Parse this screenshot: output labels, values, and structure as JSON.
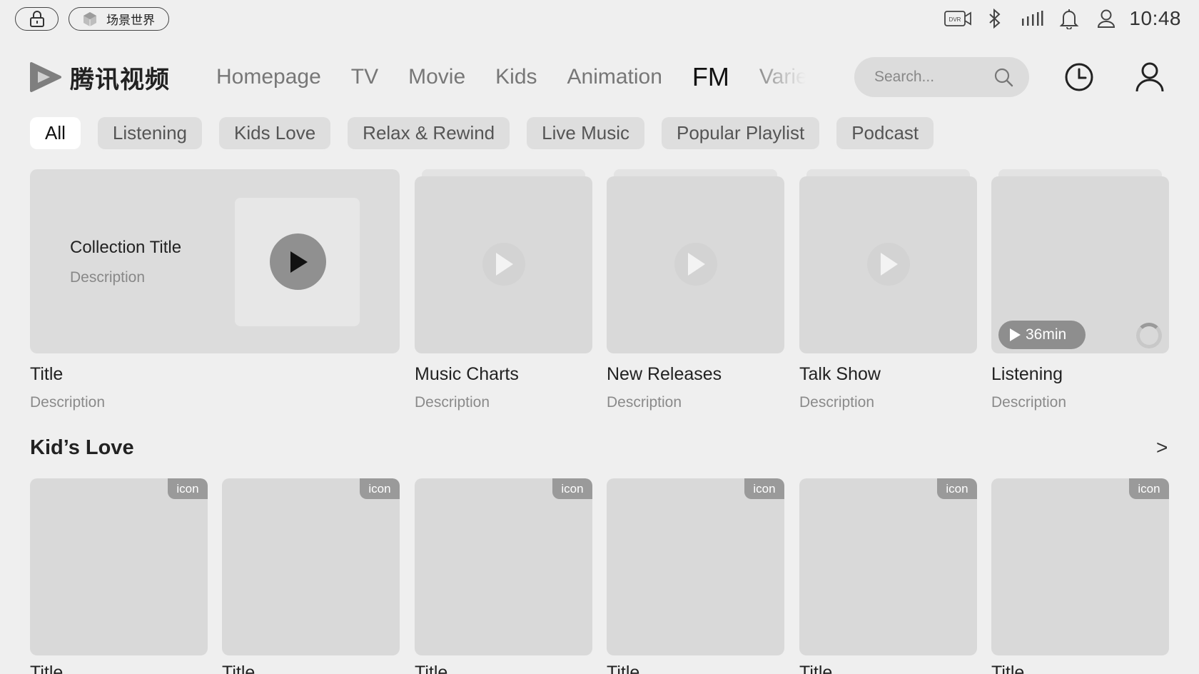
{
  "status_bar": {
    "scene_label": "场景世界",
    "time": "10:48",
    "dvr_label": "DVR",
    "icons": [
      "lock-icon",
      "scene-cube-icon",
      "dvr-icon",
      "bluetooth-icon",
      "signal-icon",
      "notification-icon",
      "profile-icon"
    ]
  },
  "header": {
    "logo_text": "腾讯视频",
    "nav": [
      "Homepage",
      "TV",
      "Movie",
      "Kids",
      "Animation",
      "FM",
      "Varie"
    ],
    "active_nav": "FM",
    "search_placeholder": "Search..."
  },
  "chips": [
    "All",
    "Listening",
    "Kids Love",
    "Relax & Rewind",
    "Live Music",
    "Popular Playlist",
    "Podcast"
  ],
  "active_chip": "All",
  "featured": {
    "collection_title": "Collection Title",
    "collection_description": "Description",
    "title": "Title",
    "description": "Description"
  },
  "cards": [
    {
      "title": "Music Charts",
      "description": "Description"
    },
    {
      "title": "New Releases",
      "description": "Description"
    },
    {
      "title": "Talk Show",
      "description": "Description"
    },
    {
      "title": "Listening",
      "description": "Description",
      "duration": "36min"
    }
  ],
  "kids_section": {
    "title": "Kid’s Love",
    "more": ">",
    "items": [
      {
        "tag": "icon",
        "title": "Title"
      },
      {
        "tag": "icon",
        "title": "Title"
      },
      {
        "tag": "icon",
        "title": "Title"
      },
      {
        "tag": "icon",
        "title": "Title"
      },
      {
        "tag": "icon",
        "title": "Title"
      },
      {
        "tag": "icon",
        "title": "Title"
      }
    ]
  },
  "colors": {
    "background": "#efefef",
    "card": "#d9d9d9",
    "chip": "#dedede",
    "chip_active": "#ffffff",
    "play_button": "#909090"
  }
}
